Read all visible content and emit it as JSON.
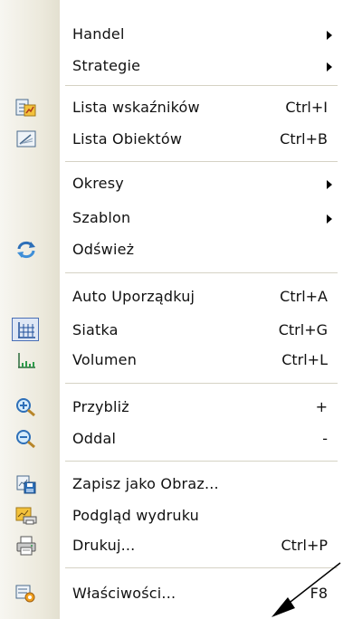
{
  "menu": {
    "items": [
      {
        "label": "Handel",
        "shortcut": "",
        "submenu": true,
        "icon": ""
      },
      {
        "label": "Strategie",
        "shortcut": "",
        "submenu": true,
        "icon": ""
      },
      {
        "label": "Lista wskaźników",
        "shortcut": "Ctrl+I",
        "submenu": false,
        "icon": "indicators-list-icon"
      },
      {
        "label": "Lista Obiektów",
        "shortcut": "Ctrl+B",
        "submenu": false,
        "icon": "objects-list-icon"
      },
      {
        "label": "Okresy",
        "shortcut": "",
        "submenu": true,
        "icon": ""
      },
      {
        "label": "Szablon",
        "shortcut": "",
        "submenu": true,
        "icon": ""
      },
      {
        "label": "Odśwież",
        "shortcut": "",
        "submenu": false,
        "icon": "refresh-icon"
      },
      {
        "label": "Auto Uporządkuj",
        "shortcut": "Ctrl+A",
        "submenu": false,
        "icon": ""
      },
      {
        "label": "Siatka",
        "shortcut": "Ctrl+G",
        "submenu": false,
        "icon": "grid-icon",
        "checked": true
      },
      {
        "label": "Volumen",
        "shortcut": "Ctrl+L",
        "submenu": false,
        "icon": "volume-icon"
      },
      {
        "label": "Przybliż",
        "shortcut": "+",
        "submenu": false,
        "icon": "zoom-in-icon"
      },
      {
        "label": "Oddal",
        "shortcut": "-",
        "submenu": false,
        "icon": "zoom-out-icon"
      },
      {
        "label": "Zapisz jako Obraz...",
        "shortcut": "",
        "submenu": false,
        "icon": "save-as-image-icon"
      },
      {
        "label": "Podgląd wydruku",
        "shortcut": "",
        "submenu": false,
        "icon": "print-preview-icon"
      },
      {
        "label": "Drukuj...",
        "shortcut": "Ctrl+P",
        "submenu": false,
        "icon": "printer-icon"
      },
      {
        "label": "Właściwości...",
        "shortcut": "F8",
        "submenu": false,
        "icon": "properties-icon"
      }
    ]
  },
  "colors": {
    "gutter": "#ece9dc",
    "separator": "#d5d2c4",
    "checked_border": "#4a6fb5",
    "checked_fill": "#dfe7f5"
  }
}
